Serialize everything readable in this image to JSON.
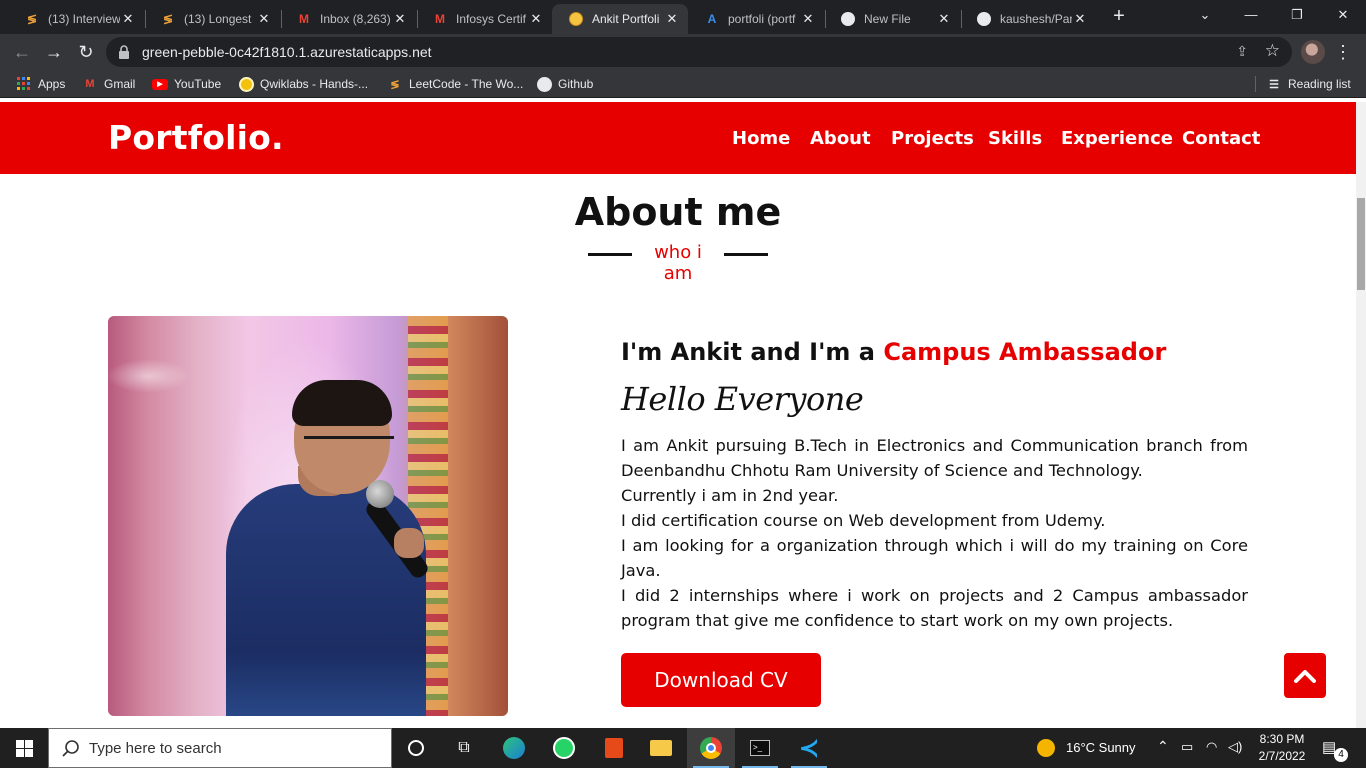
{
  "browser": {
    "tabs": [
      {
        "title": "(13) Interview",
        "favicon": "hackerearth-icon"
      },
      {
        "title": "(13) Longest",
        "favicon": "hackerearth-icon"
      },
      {
        "title": "Inbox (8,263)",
        "favicon": "gmail-icon"
      },
      {
        "title": "Infosys Certif",
        "favicon": "gmail-icon"
      },
      {
        "title": "Ankit Portfoli",
        "favicon": "emoji-icon",
        "active": true
      },
      {
        "title": "portfoli (portf",
        "favicon": "azure-icon"
      },
      {
        "title": "New File",
        "favicon": "github-icon"
      },
      {
        "title": "kaushesh/Par",
        "favicon": "github-icon"
      }
    ],
    "url": "green-pebble-0c42f1810.1.azurestaticapps.net",
    "bookmarks": [
      {
        "label": "Apps",
        "icon": "apps-grid-icon"
      },
      {
        "label": "Gmail",
        "icon": "gmail-icon"
      },
      {
        "label": "YouTube",
        "icon": "youtube-icon"
      },
      {
        "label": "Qwiklabs - Hands-...",
        "icon": "qwiklabs-icon"
      },
      {
        "label": "LeetCode - The Wo...",
        "icon": "leetcode-icon"
      },
      {
        "label": "Github",
        "icon": "github-icon"
      }
    ],
    "reading_list": "Reading list"
  },
  "site": {
    "logo": "Portfolio.",
    "nav": [
      "Home",
      "About",
      "Projects",
      "Skills",
      "Experience",
      "Contact"
    ],
    "about": {
      "title": "About me",
      "subtitle": "who i am",
      "headline_prefix": "I'm Ankit and I'm a ",
      "headline_accent": "Campus Ambassador",
      "greeting": "Hello Everyone",
      "bio": [
        "I am Ankit pursuing B.Tech in Electronics and Communication branch from Deenbandhu Chhotu Ram University of Science and Technology.",
        "Currently i am in 2nd year.",
        "I did certification course on Web development from Udemy.",
        "I am looking for a organization through which i will do my training on Core Java.",
        "I did 2 internships where i work on projects and 2 Campus ambassador program that give me confidence to start work on my own projects."
      ],
      "cv_button": "Download CV"
    },
    "colors": {
      "accent": "#e60000"
    }
  },
  "taskbar": {
    "search_placeholder": "Type here to search",
    "weather": "16°C  Sunny",
    "time": "8:30 PM",
    "date": "2/7/2022",
    "notifications": "4"
  }
}
